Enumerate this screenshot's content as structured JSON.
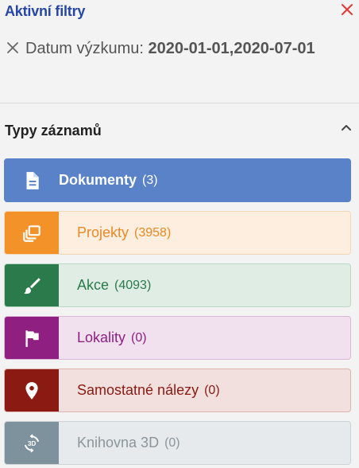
{
  "header": {
    "title": "Aktivní filtry",
    "close_icon": "close-icon",
    "accent_color": "#2546a8",
    "close_color": "#e53935"
  },
  "active_filters": [
    {
      "label": "Datum výzkumu:",
      "value": "2020-01-01,2020-07-01",
      "remove_icon": "close-icon"
    }
  ],
  "section": {
    "title": "Typy záznamů",
    "toggle_icon": "chevron-up-icon"
  },
  "record_types": [
    {
      "label": "Dokumenty",
      "count": "(3)",
      "icon": "document-icon",
      "color": "#5a82c8",
      "selected": true
    },
    {
      "label": "Projekty",
      "count": "(3958)",
      "icon": "stacked-windows-icon",
      "color": "#f4922a",
      "selected": false
    },
    {
      "label": "Akce",
      "count": "(4093)",
      "icon": "brush-icon",
      "color": "#2b7a4b",
      "selected": false
    },
    {
      "label": "Lokality",
      "count": "(0)",
      "icon": "flag-icon",
      "color": "#8f1f80",
      "selected": false
    },
    {
      "label": "Samostatné nálezy",
      "count": "(0)",
      "icon": "location-pin-icon",
      "color": "#8b1a12",
      "selected": false
    },
    {
      "label": "Knihovna 3D",
      "count": "(0)",
      "icon": "3d-rotation-icon",
      "color": "#7e929e",
      "selected": false
    }
  ]
}
